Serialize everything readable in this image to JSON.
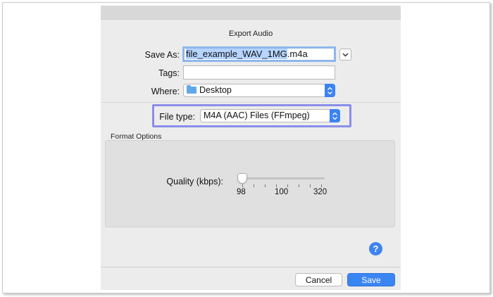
{
  "dialog": {
    "title": "Export Audio",
    "save_as": {
      "label": "Save As:",
      "filename_selected": "file_example_WAV_1MG",
      "filename_extension": ".m4a"
    },
    "tags": {
      "label": "Tags:",
      "value": ""
    },
    "where": {
      "label": "Where:",
      "value": "Desktop"
    },
    "file_type": {
      "label": "File type:",
      "value": "M4A (AAC) Files (FFmpeg)"
    },
    "format_options": {
      "label": "Format Options",
      "quality": {
        "label": "Quality (kbps):",
        "value": 98,
        "tick_labels": [
          "98",
          "100",
          "320"
        ]
      }
    },
    "help_label": "?",
    "cancel_label": "Cancel",
    "save_label": "Save"
  },
  "colors": {
    "accent": "#3b82f2",
    "highlight_border": "#8a8ee8",
    "dialog_bg": "#ececec"
  }
}
